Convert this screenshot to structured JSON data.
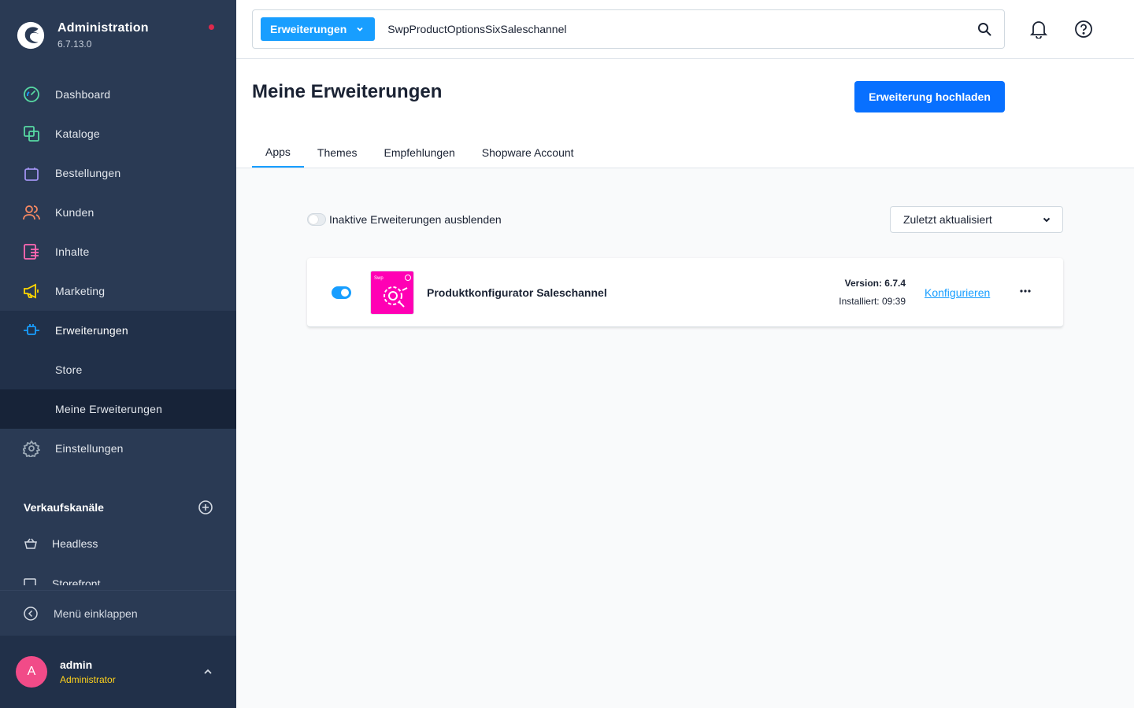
{
  "brand": {
    "title": "Administration",
    "version": "6.7.13.0"
  },
  "nav": {
    "items": [
      {
        "label": "Dashboard",
        "icon": "gauge-icon",
        "color": "#57d9a3"
      },
      {
        "label": "Kataloge",
        "icon": "products-icon",
        "color": "#57d9a3"
      },
      {
        "label": "Bestellungen",
        "icon": "shopping-bag-icon",
        "color": "#a092f0"
      },
      {
        "label": "Kunden",
        "icon": "users-icon",
        "color": "#f88962"
      },
      {
        "label": "Inhalte",
        "icon": "content-icon",
        "color": "#ff68b4"
      },
      {
        "label": "Marketing",
        "icon": "megaphone-icon",
        "color": "#ffd700"
      },
      {
        "label": "Erweiterungen",
        "icon": "plug-icon",
        "color": "#189eff"
      },
      {
        "label": "Store"
      },
      {
        "label": "Meine Erweiterungen"
      },
      {
        "label": "Einstellungen",
        "icon": "gear-icon",
        "color": "#9aa8b5"
      }
    ]
  },
  "sales_channels": {
    "title": "Verkaufskanäle",
    "items": [
      {
        "label": "Headless"
      },
      {
        "label": "Storefront"
      }
    ]
  },
  "collapse_label": "Menü einklappen",
  "user": {
    "initial": "A",
    "name": "admin",
    "role": "Administrator"
  },
  "search": {
    "type_label": "Erweiterungen",
    "value": "SwpProductOptionsSixSaleschannel"
  },
  "page": {
    "title": "Meine Erweiterungen",
    "upload_label": "Erweiterung hochladen",
    "tabs": [
      {
        "label": "Apps",
        "active": true
      },
      {
        "label": "Themes"
      },
      {
        "label": "Empfehlungen"
      },
      {
        "label": "Shopware Account"
      }
    ]
  },
  "filter": {
    "hide_inactive_label": "Inaktive Erweiterungen ausblenden",
    "sort_value": "Zuletzt aktualisiert"
  },
  "extension": {
    "name": "Produktkonfigurator Saleschannel",
    "version": "Version: 6.7.4",
    "installed": "Installiert: 09:39",
    "configure_label": "Konfigurieren",
    "active": true,
    "icon_text": "Swp",
    "icon_color": "#ff00b4"
  },
  "colors": {
    "accent": "#189eff",
    "primary_button": "#0870ff",
    "sidebar": "#2a3a54"
  }
}
